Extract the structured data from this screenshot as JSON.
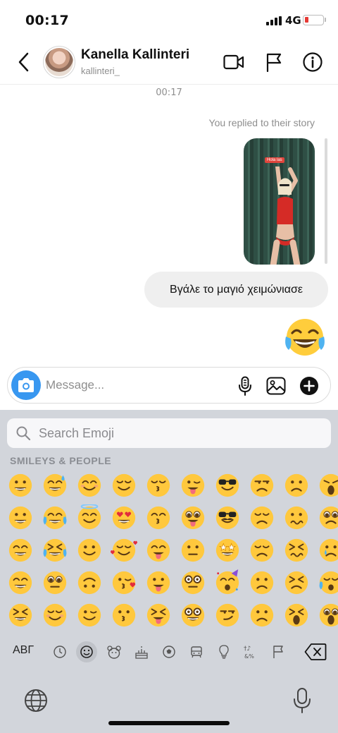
{
  "status": {
    "time": "00:17",
    "network": "4G"
  },
  "header": {
    "name": "Kanella Kallinteri",
    "username": "kallinteri_"
  },
  "conversation": {
    "timestamp": "00:17",
    "replied_label": "You replied to their story",
    "story_tag": "Hola las",
    "message_text": "Βγάλε το μαγιό χειμώνιασε"
  },
  "composer": {
    "placeholder": "Message..."
  },
  "keyboard": {
    "search_placeholder": "Search Emoji",
    "section_label": "SMILEYS & PEOPLE",
    "alphabet_key": "ΑΒΓ",
    "categories": [
      "recent-icon",
      "smiley-icon",
      "animal-icon",
      "food-icon",
      "activity-icon",
      "travel-icon",
      "objects-icon",
      "symbols-icon",
      "flag-icon"
    ],
    "active_category": "smiley-icon",
    "emoji_grid": [
      [
        "grinning",
        "sweat-smile",
        "blush",
        "relieved",
        "kissing-closed-eyes",
        "winking-tongue",
        "sunglasses",
        "unamused",
        "frowning",
        "weary"
      ],
      [
        "grin-big",
        "joy",
        "halo",
        "heart-eyes",
        "kissing-smiling",
        "zany",
        "disguise",
        "disappointed",
        "confused",
        "pleading"
      ],
      [
        "smile",
        "rofl",
        "slight-smile",
        "smiling-hearts",
        "yum",
        "raised-eyebrow",
        "star-struck",
        "pensive",
        "confounded",
        "cry"
      ],
      [
        "beaming",
        "holding-tears",
        "upside-down",
        "kissing-heart",
        "tongue-out",
        "monocle",
        "partying",
        "worried",
        "persevering",
        "sob"
      ],
      [
        "laughing",
        "smiling-face",
        "wink",
        "kissing",
        "squinting-tongue",
        "nerd",
        "smirk",
        "slight-frown",
        "tired",
        "scream"
      ]
    ]
  }
}
